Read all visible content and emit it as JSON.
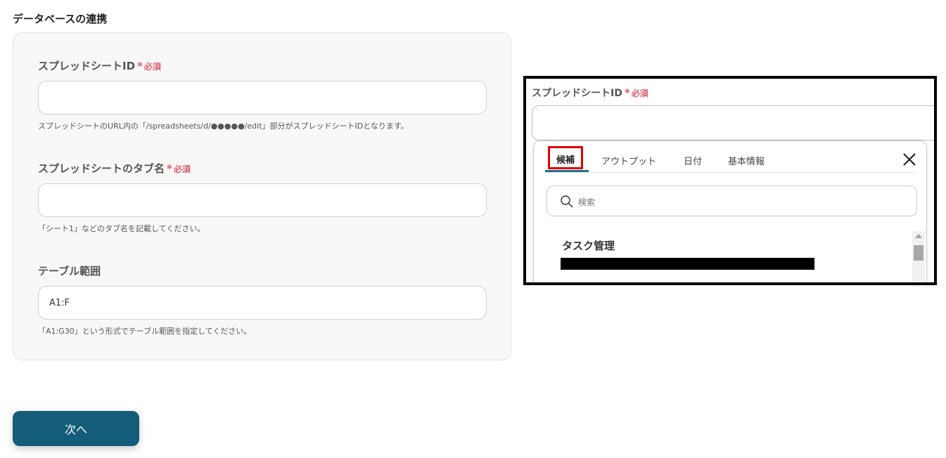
{
  "section_title": "データベースの連携",
  "required_star": "*",
  "required_text": "必須",
  "fields": [
    {
      "label": "スプレッドシートID",
      "required": true,
      "value": "",
      "help": "スプレッドシートのURL内の「/spreadsheets/d/●●●●●/edit」部分がスプレッドシートIDとなります。"
    },
    {
      "label": "スプレッドシートのタブ名",
      "required": true,
      "value": "",
      "help": "「シート1」などのタブ名を記載してください。"
    },
    {
      "label": "テーブル範囲",
      "required": false,
      "value": "A1:F",
      "help": "「A1:G30」という形式でテーブル範囲を指定してください。"
    }
  ],
  "next_button_label": "次へ",
  "zoom": {
    "label": "スプレッドシートID",
    "tabs": [
      "候補",
      "アウトプット",
      "日付",
      "基本情報"
    ],
    "active_tab": "候補",
    "search_placeholder": "検索",
    "result_title": "タスク管理",
    "icons": {
      "close": "close-icon",
      "search": "search-icon"
    },
    "highlight_color": "#e00000",
    "accent_color": "#1f6f8b"
  }
}
